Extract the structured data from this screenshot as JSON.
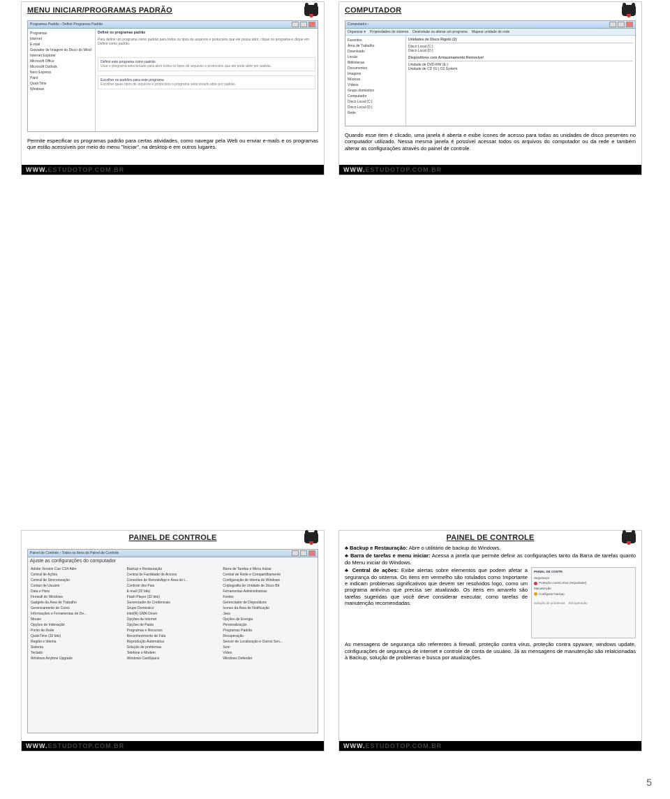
{
  "page_number": "5",
  "footer_visible": "WWW.",
  "footer_faded": "ESTUDOTOP.COM.BR",
  "cards": {
    "top_left": {
      "title": "MENU INICIAR/PROGRAMAS PADRÃO",
      "desc": "Permite especificar os programas padrão para certas atividades, como navegar pela Web ou enviar e-mails e os programas que estão acessíveis por meio do menu \"Iniciar\", na desktop e em outros lugares."
    },
    "top_right": {
      "title": "COMPUTADOR",
      "desc": "Quando esse item é clicado, uma janela é aberta e exibe ícones de acesso para todas as unidades de disco presentes no computador utilizado. Nessa mesma janela é possível acessar todos os arquivos do computador ou da rede e também alterar as configurações através do painel de controle."
    },
    "bottom_left": {
      "title": "PAINEL DE CONTROLE",
      "cp_header": "Ajuste as configurações do computador"
    },
    "bottom_right": {
      "title": "PAINEL DE CONTROLE",
      "inset_title": "PAINEL DE CONTR",
      "b1_label": "Backup e Restauração:",
      "b1_text": " Abre o utilitário de backup do Windows.",
      "b2_label": "Barra de tarefas e menu iniciar:",
      "b2_text": " Acessa a janela que permite definir as configurações tanto da Barra de tarefas quanto do Menu iniciar do Windows.",
      "b3_label": "Central de ações:",
      "b3_text": " Exibe alertas sobre elementos que podem afetar a segurança do sistema. Os itens em vermelho são rotulados como Importante e indicam problemas significativos que devem ser resolvidos logo, como um programa antivírus que precisa ser atualizado. Os itens em amarelo são tarefas sugeridas que você deve considerar executar, como tarefas de manutenção recomendadas.",
      "b3_tail": "As mensagens de segurança são referentes à firewall, proteção contra vírus, proteção contra spyware, windows update, configurações de segurança de internet e controle de conta de usuário. Já as mensagens de manutenção são relalcionadas à Backup, solução de problemas e busca por atualizações."
    }
  },
  "win7": {
    "progpad_side": [
      "Programas",
      "Internet",
      "E-mail",
      "Gravador de Imagem do Disco do Wind",
      "Internet Explorer",
      "Microsoft Office",
      "Microsoft Outlook",
      "Nero Express",
      "Paint",
      "QuickTime",
      "Windows"
    ],
    "progpad_main_title": "Definir os programas padrão",
    "explorer_side": [
      "Favoritos",
      "Área de Trabalho",
      "Downloads",
      "Locais",
      "Bibliotecas",
      "Documentos",
      "Imagens",
      "Músicas",
      "Vídeos",
      "Grupo doméstico",
      "Computador",
      "Disco Local (C:)",
      "Disco Local (D:)",
      "Rede"
    ],
    "explorer_hd_hdr": "Unidades de Disco Rígido (2)",
    "explorer_hd": [
      "Disco Local (C:)",
      "Disco Local (D:)"
    ],
    "explorer_rem_hdr": "Dispositivos com Armazenamento Removível",
    "explorer_rem": [
      "Unidade de DVD-RW (E:)",
      "Unidade de CD (G:) O2 System"
    ],
    "cp_items": [
      "Adobe Version Cue CS4 Adm",
      "Backup e Restauração",
      "Barra de Tarefas e Menu Iniciar",
      "Central de Ações",
      "Central de Facilidade de Acesso",
      "Central de Rede e Compartilhamento",
      "Central de Sincronização",
      "Conexões de RemoteApp e Área de t...",
      "Configuração de Idioma do Windows",
      "Contas de Usuário",
      "Controle dos Pais",
      "Criptografia de Unidade de Disco Bit",
      "Data e Hora",
      "E-mail (32 bits)",
      "Ferramentas Administrativas",
      "Firewall do Windows",
      "Flash Player (32 bits)",
      "Fontes",
      "Gadgets da Área de Trabalho",
      "Gerenciador de Credenciais",
      "Gerenciador de Dispositivos",
      "Gerenciamento de Cores",
      "Grupo Doméstico",
      "Ícones da Área de Notificação",
      "Informações e Ferramentas de De...",
      "Intel(R) GMA Driver",
      "Java",
      "Mouse",
      "Opções da Internet",
      "Opções de Energia",
      "Opções de Indexação",
      "Opções de Pasta",
      "Personalização",
      "Ponto de Rede",
      "Programas e Recursos",
      "Programas Padrão",
      "QuickTime (32 bits)",
      "Reconhecimento de Fala",
      "Recuperação",
      "Região e Idioma",
      "Reprodução Automática",
      "Sensor de Localização e Outros Sen...",
      "Sistema",
      "Solução de problemas",
      "Som",
      "Teclado",
      "Telefone e Modem",
      "Vídeo",
      "Windows Anytime Upgrade",
      "Windows CardSpace",
      "Windows Defender"
    ]
  }
}
